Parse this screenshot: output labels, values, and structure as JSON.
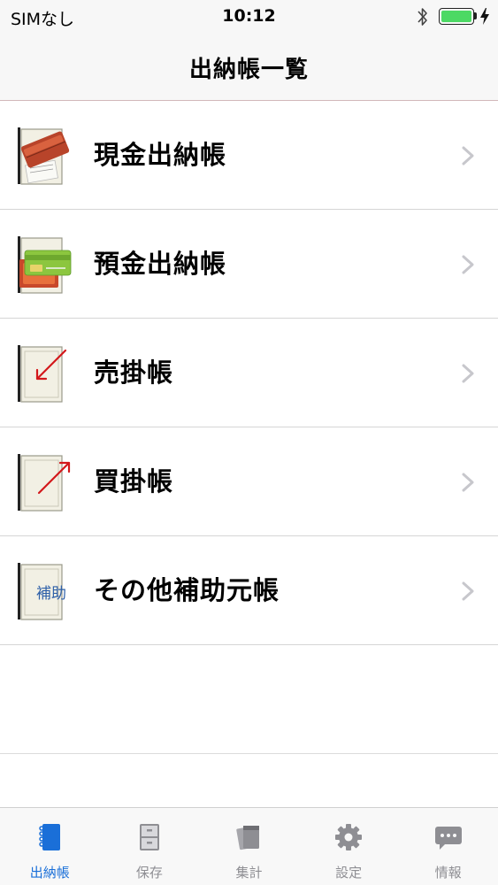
{
  "status_bar": {
    "carrier": "SIMなし",
    "time": "10:12",
    "battery_level": 1.0
  },
  "nav": {
    "title": "出納帳一覧"
  },
  "list": {
    "items": [
      {
        "label": "現金出納帳",
        "icon": "cash-ledger-icon"
      },
      {
        "label": "預金出納帳",
        "icon": "deposit-ledger-icon"
      },
      {
        "label": "売掛帳",
        "icon": "receivables-ledger-icon"
      },
      {
        "label": "買掛帳",
        "icon": "payables-ledger-icon"
      },
      {
        "label": "その他補助元帳",
        "icon": "other-subledger-icon",
        "icon_text": "補助"
      }
    ]
  },
  "tabs": [
    {
      "label": "出納帳",
      "icon": "ledger-book-icon",
      "active": true
    },
    {
      "label": "保存",
      "icon": "cabinet-icon",
      "active": false
    },
    {
      "label": "集計",
      "icon": "documents-icon",
      "active": false
    },
    {
      "label": "設定",
      "icon": "gear-icon",
      "active": false
    },
    {
      "label": "情報",
      "icon": "speech-bubble-icon",
      "active": false
    }
  ],
  "colors": {
    "accent": "#1a6fd8",
    "inactive_tab": "#8e8e93",
    "battery": "#4cd964",
    "bar_background": "#f7f7f7",
    "separator": "#d5d5d5"
  }
}
